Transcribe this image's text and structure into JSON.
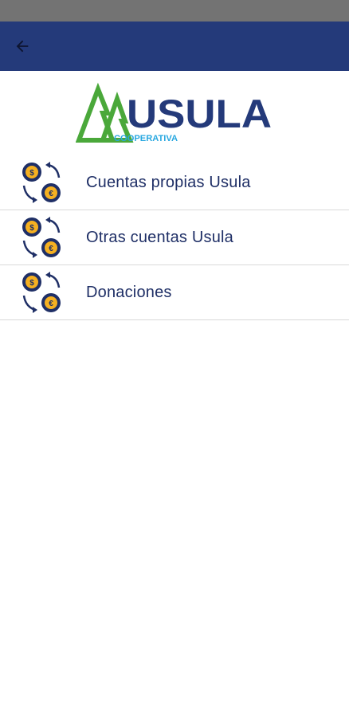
{
  "header": {
    "back_icon": "arrow-left-icon",
    "background_color": "#243a7a"
  },
  "status_bar": {
    "background_color": "#737373"
  },
  "logo": {
    "wordmark": "USULA",
    "tagline": "COOPERATIVA",
    "brand_green": "#4aa83a",
    "brand_navy": "#243a7a",
    "tagline_color": "#29a8e0"
  },
  "menu": {
    "items": [
      {
        "label": "Cuentas propias Usula",
        "icon": "coin-exchange-icon"
      },
      {
        "label": "Otras cuentas Usula",
        "icon": "coin-exchange-icon"
      },
      {
        "label": "Donaciones",
        "icon": "coin-exchange-icon"
      }
    ]
  }
}
